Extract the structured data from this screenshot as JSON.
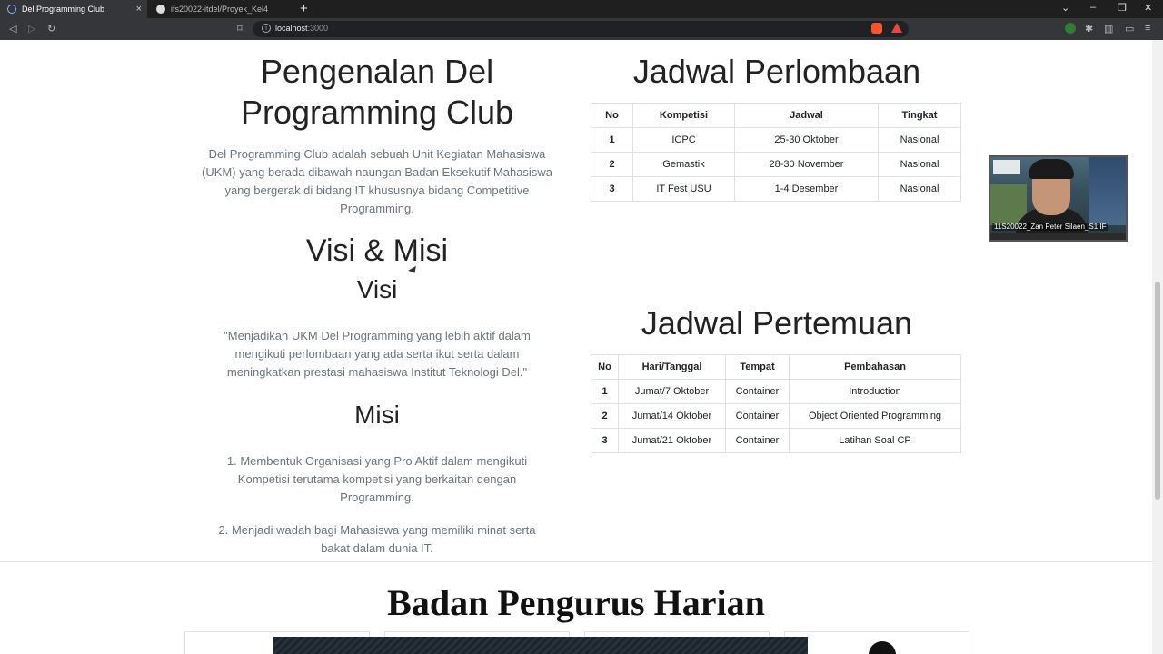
{
  "browser": {
    "tabs": [
      {
        "title": "Del Programming Club",
        "active": true
      },
      {
        "title": "ifs20022-itdel/Proyek_Kel4",
        "active": false
      }
    ],
    "address": {
      "host": "localhost",
      "port": ":3000"
    }
  },
  "about": {
    "title": "Pengenalan Del Programming Club",
    "description": "Del Programming Club adalah sebuah Unit Kegiatan Mahasiswa (UKM) yang berada dibawah naungan Badan Eksekutif Mahasiswa yang bergerak di bidang IT khususnya bidang Competitive Programming."
  },
  "vision_mission": {
    "title": "Visi & Misi",
    "vision_title": "Visi",
    "vision_text": "\"Menjadikan UKM Del Programming yang lebih aktif dalam mengikuti perlombaan yang ada serta ikut serta dalam meningkatkan prestasi mahasiswa Institut Teknologi Del.\"",
    "mission_title": "Misi",
    "missions": [
      "1. Membentuk Organisasi yang Pro Aktif dalam mengikuti Kompetisi terutama kompetisi yang berkaitan dengan Programming.",
      "2. Menjadi wadah bagi Mahasiswa yang memiliki minat serta bakat dalam dunia IT."
    ]
  },
  "competitions": {
    "title": "Jadwal Perlombaan",
    "headers": [
      "No",
      "Kompetisi",
      "Jadwal",
      "Tingkat"
    ],
    "rows": [
      [
        "1",
        "ICPC",
        "25-30 Oktober",
        "Nasional"
      ],
      [
        "2",
        "Gemastik",
        "28-30 November",
        "Nasional"
      ],
      [
        "3",
        "IT Fest USU",
        "1-4 Desember",
        "Nasional"
      ]
    ]
  },
  "meetings": {
    "title": "Jadwal Pertemuan",
    "headers": [
      "No",
      "Hari/Tanggal",
      "Tempat",
      "Pembahasan"
    ],
    "rows": [
      [
        "1",
        "Jumat/7 Oktober",
        "Container",
        "Introduction"
      ],
      [
        "2",
        "Jumat/14 Oktober",
        "Container",
        "Object Oriented Programming"
      ],
      [
        "3",
        "Jumat/21 Oktober",
        "Container",
        "Latihan Soal CP"
      ]
    ]
  },
  "board": {
    "title": "Badan Pengurus Harian"
  },
  "webcam": {
    "label": "11S20022_Zan Peter Silaen_S1 IF"
  },
  "colors": {
    "text": "#212529",
    "muted": "#6c757d",
    "border": "#dee2e6",
    "chrome": "#35363a"
  }
}
